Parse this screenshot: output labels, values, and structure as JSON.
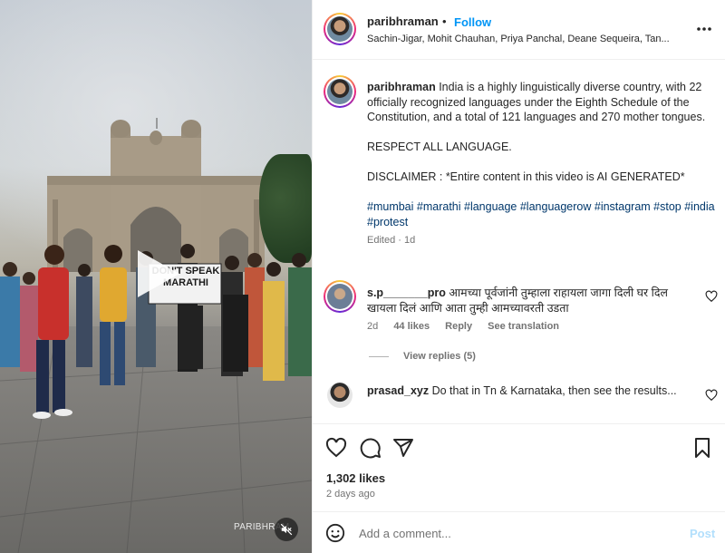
{
  "media": {
    "sign_text": "DON'T SPEAK MARATHI",
    "watermark": "PARIBHRAM",
    "icons": {
      "play": "play-icon",
      "mute": "mute-icon"
    }
  },
  "header": {
    "username": "paribhraman",
    "separator": "•",
    "follow_label": "Follow",
    "audio": "Sachin-Jigar, Mohit Chauhan, Priya Panchal, Deane Sequeira, Tan...",
    "more_icon": "more-options-icon"
  },
  "caption": {
    "username": "paribhraman",
    "text_1": "India is a highly linguistically diverse country, with 22 officially recognized languages under the Eighth Schedule of the Constitution, and a total of 121 languages and 270 mother tongues.",
    "text_2": "RESPECT ALL LANGUAGE.",
    "text_3": "DISCLAIMER : *Entire content in this video is AI GENERATED*",
    "hashtags": "#mumbai #marathi #language #languagerow #instagram #stop #india #protest",
    "edited": "Edited",
    "age": "1d"
  },
  "comments": [
    {
      "username": "s.p_______pro",
      "text": "आमच्या पूर्वजांनी तुम्हाला राहायला जागा दिली घर दिल खायला दिलं आणि आता तुम्ही आमच्यावरती उडता",
      "age": "2d",
      "likes": "44 likes",
      "reply_label": "Reply",
      "translate_label": "See translation",
      "view_replies": "View replies (5)"
    },
    {
      "username": "prasad_xyz",
      "text": "Do that in Tn & Karnataka, then see the results...",
      "age": "",
      "likes": ""
    }
  ],
  "actions": {
    "likes_count": "1,302 likes",
    "posted": "2 days ago",
    "icons": [
      "heart-icon",
      "comment-icon",
      "share-icon",
      "bookmark-icon"
    ]
  },
  "add_comment": {
    "placeholder": "Add a comment...",
    "post_label": "Post",
    "emoji_icon": "emoji-icon"
  },
  "colors": {
    "link_blue": "#0095f6",
    "hashtag": "#00376b",
    "muted": "#737373",
    "post_disabled": "#b2dffc"
  }
}
